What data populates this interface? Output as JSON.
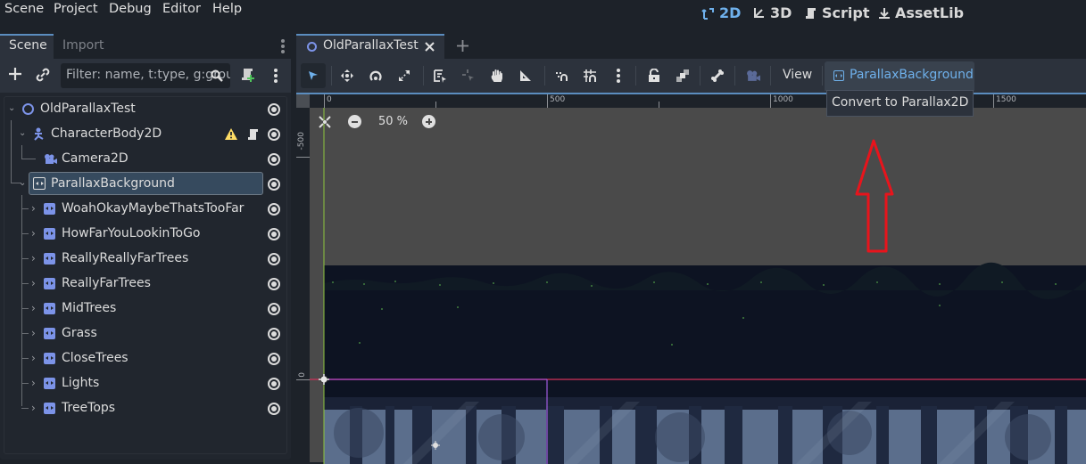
{
  "menubar": {
    "items": [
      "Scene",
      "Project",
      "Debug",
      "Editor",
      "Help"
    ],
    "workspaces": [
      {
        "label": "2D",
        "icon": "2d-axes-icon",
        "active": true
      },
      {
        "label": "3D",
        "icon": "3d-axes-icon",
        "active": false
      },
      {
        "label": "Script",
        "icon": "script-icon",
        "active": false
      },
      {
        "label": "AssetLib",
        "icon": "download-icon",
        "active": false
      }
    ]
  },
  "dock": {
    "tabs": [
      "Scene",
      "Import"
    ],
    "active_tab": "Scene",
    "filter_placeholder": "Filter: name, t:type, g:group"
  },
  "tree": {
    "nodes": [
      {
        "label": "OldParallaxTest",
        "type": "Node2D",
        "icon": "node2d-circle-icon",
        "depth": 0,
        "expanded": true
      },
      {
        "label": "CharacterBody2D",
        "type": "CharacterBody2D",
        "icon": "character-body-icon",
        "depth": 1,
        "expanded": true,
        "warning": true,
        "script": true
      },
      {
        "label": "Camera2D",
        "type": "Camera2D",
        "icon": "camera-icon",
        "depth": 2
      },
      {
        "label": "ParallaxBackground",
        "type": "ParallaxBackground",
        "icon": "parallax-background-icon",
        "depth": 1,
        "expanded": true,
        "selected": true
      },
      {
        "label": "WoahOkayMaybeThatsTooFar",
        "type": "ParallaxLayer",
        "icon": "parallax-layer-icon",
        "depth": 2,
        "collapsed": true
      },
      {
        "label": "HowFarYouLookinToGo",
        "type": "ParallaxLayer",
        "icon": "parallax-layer-icon",
        "depth": 2,
        "collapsed": true
      },
      {
        "label": "ReallyReallyFarTrees",
        "type": "ParallaxLayer",
        "icon": "parallax-layer-icon",
        "depth": 2,
        "collapsed": true
      },
      {
        "label": "ReallyFarTrees",
        "type": "ParallaxLayer",
        "icon": "parallax-layer-icon",
        "depth": 2,
        "collapsed": true
      },
      {
        "label": "MidTrees",
        "type": "ParallaxLayer",
        "icon": "parallax-layer-icon",
        "depth": 2,
        "collapsed": true
      },
      {
        "label": "Grass",
        "type": "ParallaxLayer",
        "icon": "parallax-layer-icon",
        "depth": 2,
        "collapsed": true
      },
      {
        "label": "CloseTrees",
        "type": "ParallaxLayer",
        "icon": "parallax-layer-icon",
        "depth": 2,
        "collapsed": true
      },
      {
        "label": "Lights",
        "type": "ParallaxLayer",
        "icon": "parallax-layer-icon",
        "depth": 2,
        "collapsed": true
      },
      {
        "label": "TreeTops",
        "type": "ParallaxLayer",
        "icon": "parallax-layer-icon",
        "depth": 2,
        "collapsed": true
      }
    ]
  },
  "editor": {
    "scene_tab": "OldParallaxTest",
    "view_menu": "View",
    "context_button": "ParallaxBackground",
    "tooltip": "Convert to Parallax2D",
    "zoom_level": "50 %",
    "ruler_h_labels": [
      "0",
      "500",
      "1000",
      "1500"
    ],
    "ruler_v_labels": [
      "-500",
      "0"
    ]
  },
  "colors": {
    "accent": "#6fb1ec",
    "selection": "#364a5e",
    "annotation_arrow": "#e8141c",
    "warning": "#ffdd65",
    "node_icon": "#7c93e8"
  }
}
